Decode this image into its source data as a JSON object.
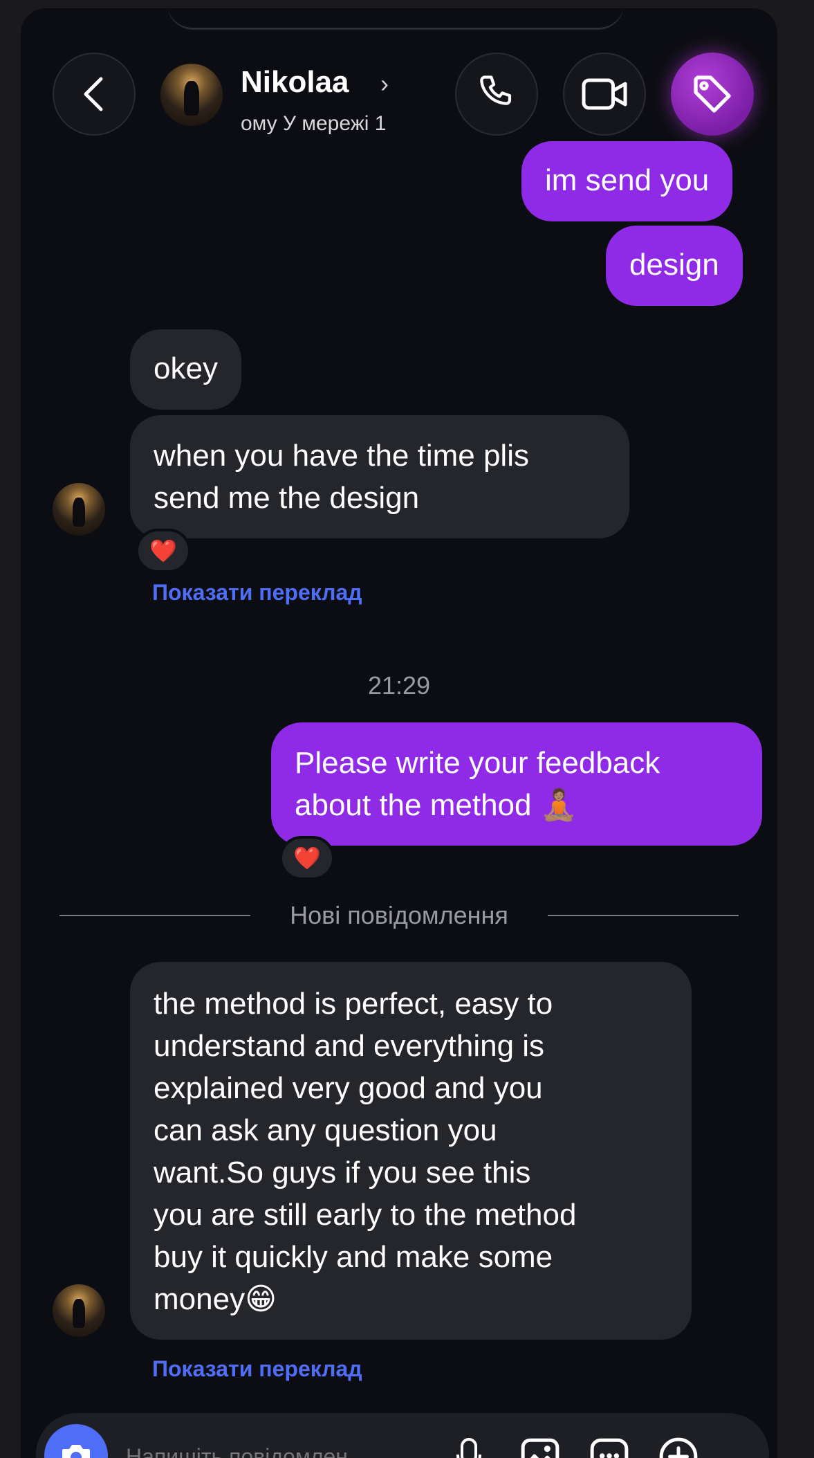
{
  "header": {
    "contact_name": "Nikolaa",
    "status_text": "ому   У мережі 1",
    "back_icon": "chevron-left-icon",
    "call_icon": "phone-icon",
    "video_icon": "video-camera-icon",
    "tag_icon": "tag-icon"
  },
  "messages": [
    {
      "direction": "outgoing",
      "text": "im send you"
    },
    {
      "direction": "outgoing",
      "text": "design"
    },
    {
      "direction": "incoming",
      "text": "okey"
    },
    {
      "direction": "incoming",
      "text": "when you have the time plis\nsend me the design",
      "reaction": "❤️",
      "translate_label": "Показати переклад"
    },
    {
      "direction": "outgoing",
      "text": "Please write your feedback\nabout the method 🧘🏽",
      "reaction": "❤️"
    },
    {
      "direction": "incoming",
      "text": "the method is perfect, easy to\nunderstand and everything is\nexplained very good and you\ncan ask any question you\nwant.So guys if you see this\nyou are still early to the method\nbuy it quickly and make some\nmoney😁",
      "translate_label": "Показати переклад"
    }
  ],
  "timestamp": "21:29",
  "new_messages_divider": "Нові повідомлення",
  "composer": {
    "placeholder": "Напишіть повідомлен...",
    "camera_icon": "camera-icon",
    "mic_icon": "microphone-icon",
    "gallery_icon": "image-icon",
    "sticker_icon": "sticker-icon",
    "plus_icon": "plus-icon"
  },
  "colors": {
    "background": "#0c0d12",
    "outgoing_bubble": "#8f2be6",
    "incoming_bubble": "#25262c",
    "link": "#4f6ef7",
    "accent_tag_button": "#a030d0"
  }
}
